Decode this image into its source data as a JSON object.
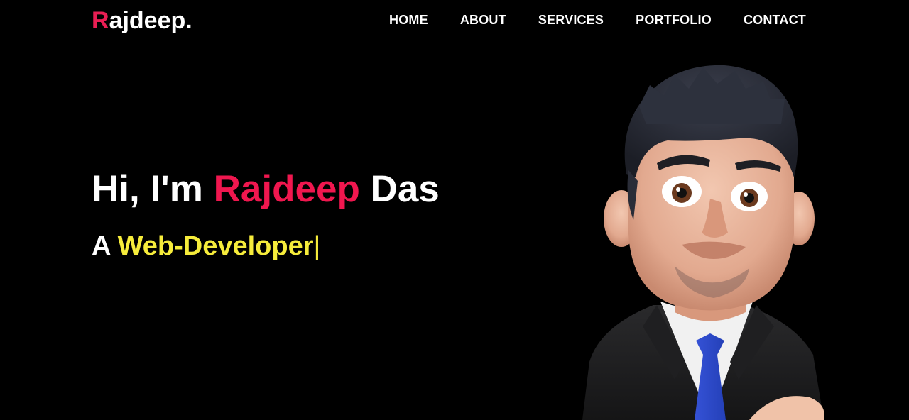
{
  "logo": {
    "first_letter": "R",
    "rest": "ajdeep."
  },
  "nav": {
    "items": [
      {
        "label": "HOME"
      },
      {
        "label": "ABOUT"
      },
      {
        "label": "SERVICES"
      },
      {
        "label": "PORTFOLIO"
      },
      {
        "label": "CONTACT"
      }
    ]
  },
  "hero": {
    "greeting": "Hi, I'm ",
    "first_name": "Rajdeep",
    "last_name": " Das",
    "prefix": "A ",
    "role": "Web-Developer",
    "cursor": "|"
  },
  "colors": {
    "background": "#000000",
    "accent": "#f0174f",
    "typed": "#f6ec3b",
    "text": "#ffffff"
  },
  "icons": {
    "avatar": "cartoon-avatar-illustration"
  }
}
